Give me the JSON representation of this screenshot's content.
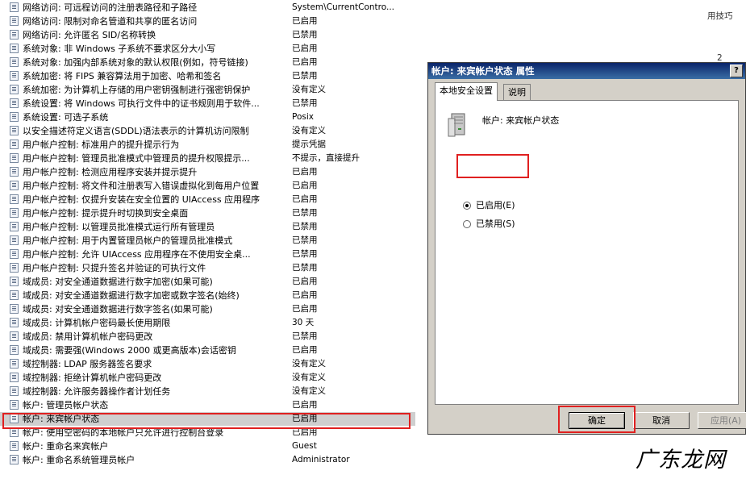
{
  "policies": [
    {
      "name": "网络访问: 可远程访问的注册表路径和子路径",
      "value": "System\\CurrentContro..."
    },
    {
      "name": "网络访问: 限制对命名管道和共享的匿名访问",
      "value": "已启用"
    },
    {
      "name": "网络访问: 允许匿名 SID/名称转换",
      "value": "已禁用"
    },
    {
      "name": "系统对象: 非 Windows 子系统不要求区分大小写",
      "value": "已启用"
    },
    {
      "name": "系统对象: 加强内部系统对象的默认权限(例如，符号链接)",
      "value": "已启用"
    },
    {
      "name": "系统加密: 将 FIPS 兼容算法用于加密、哈希和签名",
      "value": "已禁用"
    },
    {
      "name": "系统加密: 为计算机上存储的用户密钥强制进行强密钥保护",
      "value": "没有定义"
    },
    {
      "name": "系统设置: 将 Windows 可执行文件中的证书规则用于软件...",
      "value": "已禁用"
    },
    {
      "name": "系统设置: 可选子系统",
      "value": "Posix"
    },
    {
      "name": "以安全描述符定义语言(SDDL)语法表示的计算机访问限制",
      "value": "没有定义"
    },
    {
      "name": "用户帐户控制: 标准用户的提升提示行为",
      "value": "提示凭据"
    },
    {
      "name": "用户帐户控制: 管理员批准模式中管理员的提升权限提示...",
      "value": "不提示，直接提升"
    },
    {
      "name": "用户帐户控制: 检测应用程序安装并提示提升",
      "value": "已启用"
    },
    {
      "name": "用户帐户控制: 将文件和注册表写入错误虚拟化到每用户位置",
      "value": "已启用"
    },
    {
      "name": "用户帐户控制: 仅提升安装在安全位置的 UIAccess 应用程序",
      "value": "已启用"
    },
    {
      "name": "用户帐户控制: 提示提升时切换到安全桌面",
      "value": "已禁用"
    },
    {
      "name": "用户帐户控制: 以管理员批准模式运行所有管理员",
      "value": "已禁用"
    },
    {
      "name": "用户帐户控制: 用于内置管理员帐户的管理员批准模式",
      "value": "已禁用"
    },
    {
      "name": "用户帐户控制: 允许 UIAccess 应用程序在不使用安全桌...",
      "value": "已禁用"
    },
    {
      "name": "用户帐户控制: 只提升签名并验证的可执行文件",
      "value": "已禁用"
    },
    {
      "name": "域成员: 对安全通道数据进行数字加密(如果可能)",
      "value": "已启用"
    },
    {
      "name": "域成员: 对安全通道数据进行数字加密或数字签名(始终)",
      "value": "已启用"
    },
    {
      "name": "域成员: 对安全通道数据进行数字签名(如果可能)",
      "value": "已启用"
    },
    {
      "name": "域成员: 计算机帐户密码最长使用期限",
      "value": "30 天"
    },
    {
      "name": "域成员: 禁用计算机帐户密码更改",
      "value": "已禁用"
    },
    {
      "name": "域成员: 需要强(Windows 2000 或更高版本)会话密钥",
      "value": "已启用"
    },
    {
      "name": "域控制器: LDAP 服务器签名要求",
      "value": "没有定义"
    },
    {
      "name": "域控制器: 拒绝计算机帐户密码更改",
      "value": "没有定义"
    },
    {
      "name": "域控制器: 允许服务器操作者计划任务",
      "value": "没有定义"
    },
    {
      "name": "帐户: 管理员帐户状态",
      "value": "已启用"
    },
    {
      "name": "帐户: 来宾帐户状态",
      "value": "已启用",
      "selected": true
    },
    {
      "name": "帐户: 使用空密码的本地帐户只允许进行控制台登录",
      "value": "已启用"
    },
    {
      "name": "帐户: 重命名来宾帐户",
      "value": "Guest"
    },
    {
      "name": "帐户: 重命名系统管理员帐户",
      "value": "Administrator"
    }
  ],
  "background_right": {
    "frag1": "用技巧",
    "frag2": "2"
  },
  "dialog": {
    "title": "帐户: 来宾帐户状态 属性",
    "help": "?",
    "tabs": [
      "本地安全设置",
      "说明"
    ],
    "policy_title": "帐户: 来宾帐户状态",
    "options": {
      "enabled": "已启用(E)",
      "disabled": "已禁用(S)"
    },
    "selected_option": "enabled",
    "buttons": {
      "ok": "确定",
      "cancel": "取消",
      "apply": "应用(A)"
    }
  },
  "watermark": "广东龙网"
}
